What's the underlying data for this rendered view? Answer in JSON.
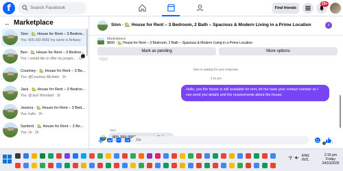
{
  "topbar": {
    "logo_letter": "f",
    "search_placeholder": "Search Facebook",
    "find_friends_label": "Find friends",
    "notification_count": "20+"
  },
  "sidebar": {
    "title": "Marketplace",
    "conversations": [
      {
        "title": "Sinn · 🏡 House for Rent – 3 Bedroo...",
        "subtitle": "You: 805-393-9583 my name is Brittany",
        "time": "",
        "active": true,
        "unread": false
      },
      {
        "title": "Ben · 🏡 House for Rent – 3 Bedroo...",
        "subtitle": "You: I would like to offer my proper... · 1h",
        "time": "1h",
        "active": false,
        "unread": true
      },
      {
        "title": "Courtney · 🏡 House for Rent – 3 Be...",
        "subtitle": "You: @Courtney Michelle · 1h",
        "time": "1h",
        "active": false,
        "unread": false
      },
      {
        "title": "Jack · 🏡 House for Rent – 3 Bedroo...",
        "subtitle": "You: @Jack Woodard · 1h",
        "time": "1h",
        "active": false,
        "unread": false
      },
      {
        "title": "Jessica · 🏡 House for Rent – 3 Bed...",
        "subtitle": "You: hallo · 2h",
        "time": "2h",
        "active": false,
        "unread": false
      },
      {
        "title": "Sanford · 🏡 House for Rent – 3 Be...",
        "subtitle": "You: ok · 2h",
        "time": "2h",
        "active": false,
        "unread": false
      }
    ]
  },
  "chat": {
    "header_title": "Sinn · 🏡 House for Rent – 3 Bedroom, 2 Bath – Spacious & Modern Living in a Prime Location",
    "marketplace_label": "Marketplace",
    "listing_line": "$600 · 🏡 House for Rent – 3 Bedroom, 2 Bath – Spacious & Modern Living in a Prime Location",
    "mark_pending_label": "Mark as pending",
    "more_options_label": "More options",
    "system_message": "Sinn is waiting for your response.",
    "timestamp": "2:14 pm",
    "outgoing_message": "Hello, yes the house is still available for rent, let me have your contact number so I can send you details and the requirements about the house.",
    "sender_name": "Sinn",
    "incoming_message": "805-393-9583 my name is Brittany",
    "composer_placeholder": "Aa"
  },
  "taskbar": {
    "language_line1": "ENG",
    "language_line2": "INTL",
    "time": "2:16 pm",
    "day": "Friday",
    "date": "24/10/2025"
  },
  "colors": {
    "facebook_blue": "#0866ff",
    "outgoing_bubble": "#7745f5",
    "active_row": "#e7f0fd",
    "badge_red": "#e41e3f"
  }
}
